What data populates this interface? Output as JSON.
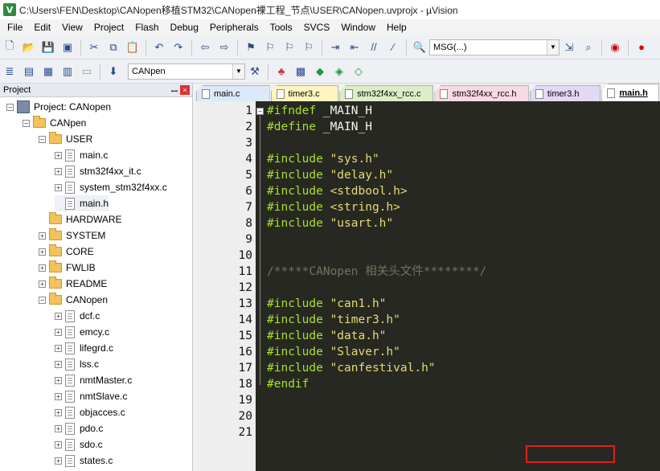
{
  "window": {
    "title": "C:\\Users\\FEN\\Desktop\\CANopen移植STM32\\CANopen裸工程_节点\\USER\\CANopen.uvprojx - µVision"
  },
  "menu": [
    "File",
    "Edit",
    "View",
    "Project",
    "Flash",
    "Debug",
    "Peripherals",
    "Tools",
    "SVCS",
    "Window",
    "Help"
  ],
  "toolbar": {
    "msg_combo": "MSG(...)",
    "target_combo": "CANpen"
  },
  "project_panel": {
    "title": "Project",
    "root": "Project: CANopen",
    "target": "CANpen",
    "items": [
      {
        "label": "USER",
        "kind": "folder",
        "exp": "−"
      },
      {
        "label": "main.c",
        "kind": "file",
        "exp": "+"
      },
      {
        "label": "stm32f4xx_it.c",
        "kind": "file",
        "exp": "+"
      },
      {
        "label": "system_stm32f4xx.c",
        "kind": "file",
        "exp": "+"
      },
      {
        "label": "main.h",
        "kind": "file",
        "exp": ""
      },
      {
        "label": "HARDWARE",
        "kind": "folder",
        "exp": ""
      },
      {
        "label": "SYSTEM",
        "kind": "folder",
        "exp": "+"
      },
      {
        "label": "CORE",
        "kind": "folder",
        "exp": "+"
      },
      {
        "label": "FWLIB",
        "kind": "folder",
        "exp": "+"
      },
      {
        "label": "README",
        "kind": "folder",
        "exp": "+"
      },
      {
        "label": "CANopen",
        "kind": "folder",
        "exp": "−"
      },
      {
        "label": "dcf.c",
        "kind": "file",
        "exp": "+"
      },
      {
        "label": "emcy.c",
        "kind": "file",
        "exp": "+"
      },
      {
        "label": "lifegrd.c",
        "kind": "file",
        "exp": "+"
      },
      {
        "label": "lss.c",
        "kind": "file",
        "exp": "+"
      },
      {
        "label": "nmtMaster.c",
        "kind": "file",
        "exp": "+"
      },
      {
        "label": "nmtSlave.c",
        "kind": "file",
        "exp": "+"
      },
      {
        "label": "objacces.c",
        "kind": "file",
        "exp": "+"
      },
      {
        "label": "pdo.c",
        "kind": "file",
        "exp": "+"
      },
      {
        "label": "sdo.c",
        "kind": "file",
        "exp": "+"
      },
      {
        "label": "states.c",
        "kind": "file",
        "exp": "+"
      }
    ]
  },
  "tabs": [
    {
      "label": "main.c",
      "color": "#dbe9fa",
      "active": false
    },
    {
      "label": "timer3.c",
      "color": "#fff6bf",
      "active": false
    },
    {
      "label": "stm32f4xx_rcc.c",
      "color": "#dcedc8",
      "active": false
    },
    {
      "label": "stm32f4xx_rcc.h",
      "color": "#f9d9e3",
      "active": false
    },
    {
      "label": "timer3.h",
      "color": "#e3d9f5",
      "active": false
    },
    {
      "label": "main.h",
      "color": "#ffffff",
      "active": true
    }
  ],
  "code": {
    "lines": [
      {
        "n": "1",
        "kw": "#ifndef",
        "rest": " _MAIN_H",
        "str": ""
      },
      {
        "n": "2",
        "kw": "#define",
        "rest": " _MAIN_H",
        "str": ""
      },
      {
        "n": "3",
        "kw": "",
        "rest": "",
        "str": ""
      },
      {
        "n": "4",
        "kw": "#include",
        "rest": " ",
        "str": "\"sys.h\""
      },
      {
        "n": "5",
        "kw": "#include",
        "rest": " ",
        "str": "\"delay.h\""
      },
      {
        "n": "6",
        "kw": "#include",
        "rest": " ",
        "str": "<stdbool.h>"
      },
      {
        "n": "7",
        "kw": "#include",
        "rest": " ",
        "str": "<string.h>"
      },
      {
        "n": "8",
        "kw": "#include",
        "rest": " ",
        "str": "\"usart.h\""
      },
      {
        "n": "9",
        "kw": "",
        "rest": "",
        "str": ""
      },
      {
        "n": "10",
        "kw": "",
        "rest": "",
        "str": ""
      },
      {
        "n": "11",
        "kw": "",
        "rest": "",
        "str": "",
        "comment": "/*****CANopen 相关头文件********/"
      },
      {
        "n": "12",
        "kw": "",
        "rest": "",
        "str": ""
      },
      {
        "n": "13",
        "kw": "#include",
        "rest": " ",
        "str": "\"can1.h\""
      },
      {
        "n": "14",
        "kw": "#include",
        "rest": " ",
        "str": "\"timer3.h\""
      },
      {
        "n": "15",
        "kw": "#include",
        "rest": " ",
        "str": "\"data.h\""
      },
      {
        "n": "16",
        "kw": "#include",
        "rest": " ",
        "str": "\"Slaver.h\""
      },
      {
        "n": "17",
        "kw": "#include",
        "rest": " ",
        "str": "\"canfestival.h\""
      },
      {
        "n": "18",
        "kw": "#endif",
        "rest": "",
        "str": ""
      },
      {
        "n": "19",
        "kw": "",
        "rest": "",
        "str": ""
      },
      {
        "n": "20",
        "kw": "",
        "rest": "",
        "str": ""
      },
      {
        "n": "21",
        "kw": "",
        "rest": "",
        "str": ""
      }
    ]
  }
}
